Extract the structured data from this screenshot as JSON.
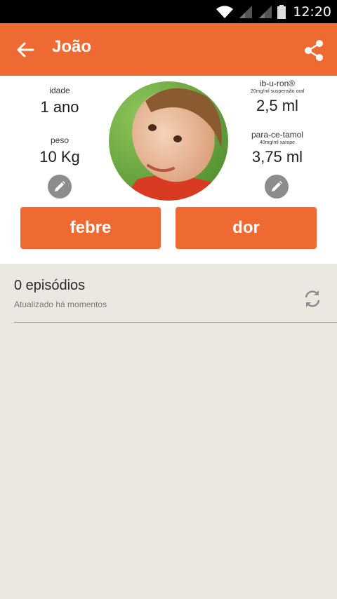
{
  "status_bar": {
    "time": "12:20"
  },
  "app_bar": {
    "title": "João",
    "colors": {
      "brand": "#ef6a32"
    }
  },
  "profile": {
    "age": {
      "label": "idade",
      "value": "1 ano"
    },
    "weight": {
      "label": "peso",
      "value": "10 Kg"
    },
    "ibuprofen": {
      "label": "ib-u-ron®",
      "detail": "20mg/ml suspensão oral",
      "value": "2,5 ml"
    },
    "paracetamol": {
      "label": "para-ce-tamol",
      "detail": "40mg/ml xarope",
      "value": "3,75 ml"
    }
  },
  "actions": {
    "fever_label": "febre",
    "pain_label": "dor"
  },
  "episodes": {
    "count_text": "0 episódios",
    "updated_text": "Atualizado há momentos"
  }
}
